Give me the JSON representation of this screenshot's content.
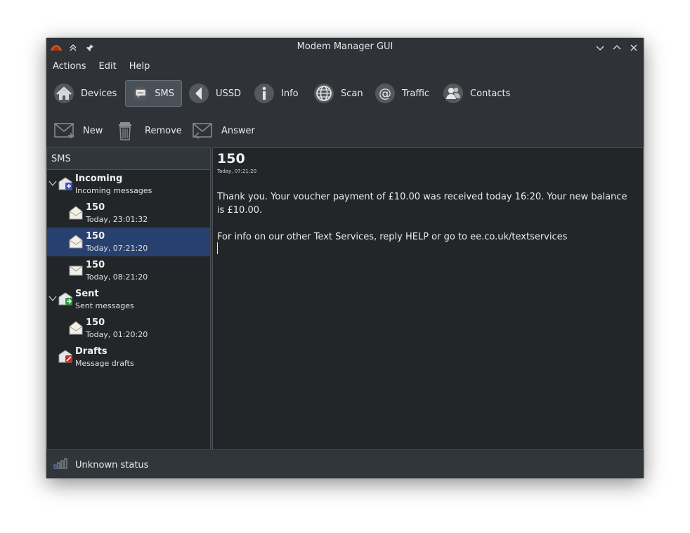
{
  "window": {
    "title": "Modem Manager GUI"
  },
  "menubar": [
    "Actions",
    "Edit",
    "Help"
  ],
  "main_toolbar": [
    {
      "label": "Devices",
      "icon": "home-icon"
    },
    {
      "label": "SMS",
      "icon": "sms-icon",
      "active": true
    },
    {
      "label": "USSD",
      "icon": "ussd-icon"
    },
    {
      "label": "Info",
      "icon": "info-icon"
    },
    {
      "label": "Scan",
      "icon": "scan-icon"
    },
    {
      "label": "Traffic",
      "icon": "traffic-icon"
    },
    {
      "label": "Contacts",
      "icon": "contacts-icon"
    }
  ],
  "sms_toolbar": [
    {
      "label": "New",
      "icon": "new-message-icon"
    },
    {
      "label": "Remove",
      "icon": "trash-icon"
    },
    {
      "label": "Answer",
      "icon": "answer-icon"
    }
  ],
  "folders": {
    "header": "SMS",
    "incoming": {
      "title": "Incoming",
      "subtitle": "Incoming messages",
      "items": [
        {
          "from": "150",
          "time": "Today, 23:01:32"
        },
        {
          "from": "150",
          "time": "Today, 07:21:20",
          "selected": true
        },
        {
          "from": "150",
          "time": "Today, 08:21:20"
        }
      ]
    },
    "sent": {
      "title": "Sent",
      "subtitle": "Sent messages",
      "items": [
        {
          "from": "150",
          "time": "Today, 01:20:20"
        }
      ]
    },
    "drafts": {
      "title": "Drafts",
      "subtitle": "Message drafts"
    }
  },
  "message": {
    "from": "150",
    "time": "Today, 07:21:20",
    "body_line1": "Thank you. Your voucher payment of £10.00 was received today 16:20. Your new balance is £10.00.",
    "body_line2": "For info on our other Text Services, reply HELP or go to ee.co.uk/textservices"
  },
  "status": {
    "text": "Unknown status",
    "icon": "signal-icon"
  },
  "colors": {
    "window_bg": "#2f3338",
    "panel_bg": "#232629",
    "selection": "#27406e"
  }
}
